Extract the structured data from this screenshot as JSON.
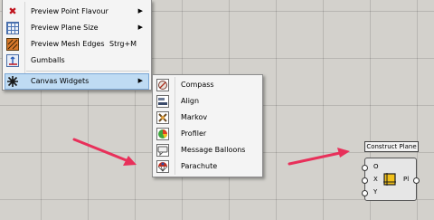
{
  "main_menu": {
    "items": [
      {
        "label": "Preview Point Flavour",
        "shortcut": "",
        "icon": "x-icon",
        "has_submenu": true
      },
      {
        "label": "Preview Plane Size",
        "shortcut": "",
        "icon": "plane-grid-icon",
        "has_submenu": true
      },
      {
        "label": "Preview Mesh Edges",
        "shortcut": "Strg+M",
        "icon": "mesh-edges-icon",
        "has_submenu": false
      },
      {
        "label": "Gumballs",
        "shortcut": "",
        "icon": "gumball-icon",
        "has_submenu": false
      },
      {
        "label": "Canvas Widgets",
        "shortcut": "",
        "icon": "widgets-icon",
        "has_submenu": true,
        "highlighted": true
      }
    ]
  },
  "submenu": {
    "items": [
      {
        "label": "Compass",
        "icon": "compass-icon"
      },
      {
        "label": "Align",
        "icon": "align-icon"
      },
      {
        "label": "Markov",
        "icon": "markov-icon"
      },
      {
        "label": "Profiler",
        "icon": "profiler-icon"
      },
      {
        "label": "Message Balloons",
        "icon": "message-balloons-icon"
      },
      {
        "label": "Parachute",
        "icon": "parachute-icon"
      }
    ]
  },
  "component": {
    "tooltip": "Construct Plane",
    "inputs": [
      "O",
      "X",
      "Y"
    ],
    "outputs": [
      "Pl"
    ]
  },
  "colors": {
    "canvas": "#d3d1cc",
    "highlight": "#bfdbf3",
    "arrow": "#e8305a"
  }
}
